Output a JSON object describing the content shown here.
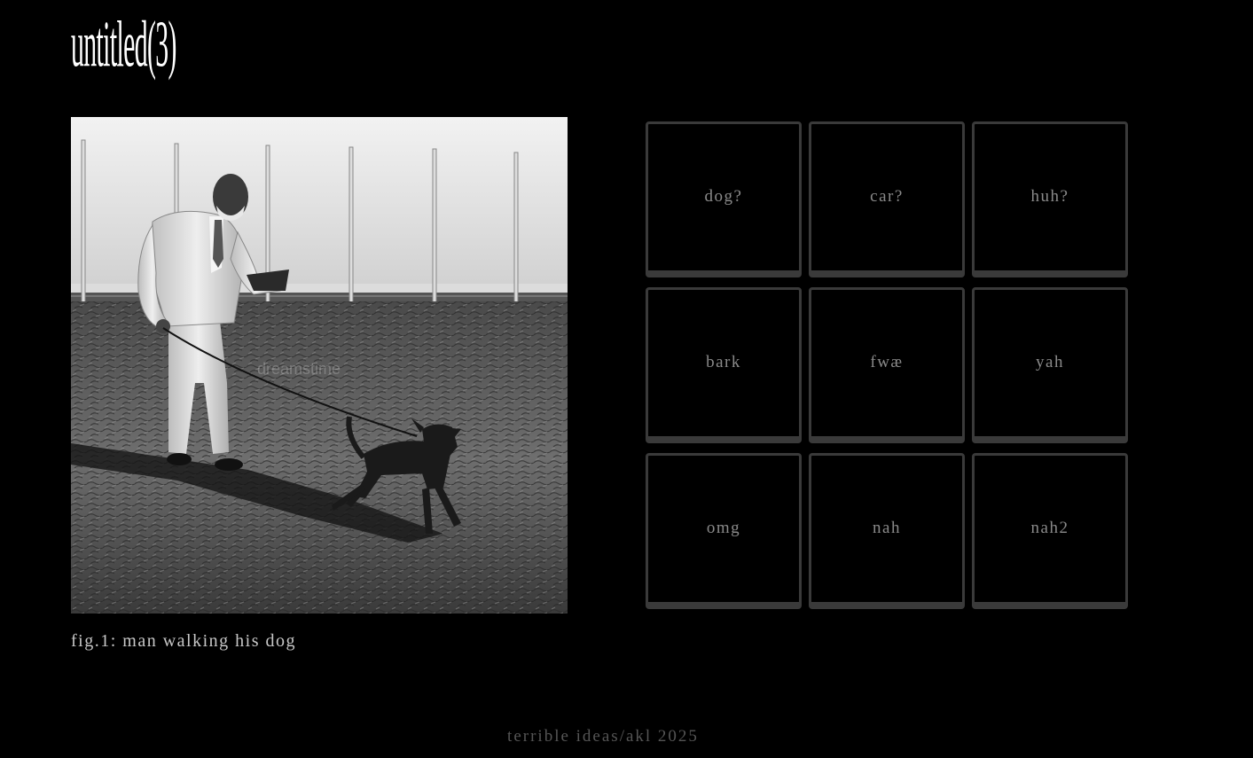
{
  "page": {
    "title": "untitled(3)"
  },
  "figure": {
    "caption": "fig.1: man walking his dog",
    "image_subject": "man-walking-dog-photo",
    "watermark": "dreamstime"
  },
  "grid": {
    "buttons": [
      {
        "label": "dog?"
      },
      {
        "label": "car?"
      },
      {
        "label": "huh?"
      },
      {
        "label": "bark"
      },
      {
        "label": "fwæ"
      },
      {
        "label": "yah"
      },
      {
        "label": "omg"
      },
      {
        "label": "nah"
      },
      {
        "label": "nah2"
      }
    ]
  },
  "footer": {
    "text": "terrible ideas/akl 2025"
  },
  "colors": {
    "background": "#000000",
    "title": "#ffffff",
    "button_border": "#3a3a3a",
    "button_text": "#8a8a8a",
    "footer_text": "#555555"
  }
}
